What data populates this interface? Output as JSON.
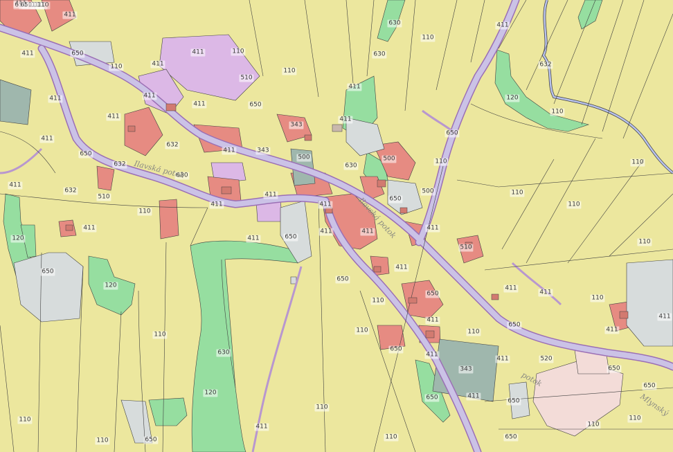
{
  "map": {
    "colors": {
      "agricultural": "#ece79e",
      "forest": "#96dea0",
      "residential": "#e68b82",
      "civic": "#dcb8e6",
      "road": "#cbc2e6",
      "road_edge": "#9b6fb5",
      "gray_parcel": "#d7dcdc",
      "dark_parcel": "#9fb7ad",
      "stream": "#b9c3ee",
      "parcel_line": "#3f3f3f",
      "commercial": "#f3dcd8"
    },
    "parcel_codes": [
      "411",
      "411",
      "411",
      "411",
      "411",
      "411",
      "411",
      "411",
      "411",
      "411",
      "411",
      "411",
      "411",
      "411",
      "411",
      "411",
      "411",
      "411",
      "411",
      "411",
      "411",
      "411",
      "411",
      "411",
      "411",
      "411",
      "411",
      "411",
      "411",
      "411",
      "411",
      "411",
      "411",
      "411",
      "650",
      "650",
      "650",
      "650",
      "650",
      "650",
      "650",
      "650",
      "650",
      "650",
      "650",
      "650",
      "650",
      "650",
      "650",
      "650",
      "650",
      "650",
      "650",
      "110",
      "110",
      "110",
      "110",
      "110",
      "110",
      "110",
      "110",
      "110",
      "110",
      "110",
      "110",
      "110",
      "110",
      "110",
      "110",
      "110",
      "110",
      "110",
      "110",
      "110",
      "110",
      "110",
      "110",
      "110",
      "110",
      "630",
      "630",
      "630",
      "630",
      "630",
      "632",
      "632",
      "632",
      "632",
      "510",
      "510",
      "510",
      "500",
      "500",
      "500",
      "343",
      "343",
      "343",
      "120",
      "120",
      "120",
      "120",
      "520"
    ],
    "streets": [
      "Ilavská potok",
      "Mlynský",
      "Ilavská potok",
      "potok"
    ]
  }
}
